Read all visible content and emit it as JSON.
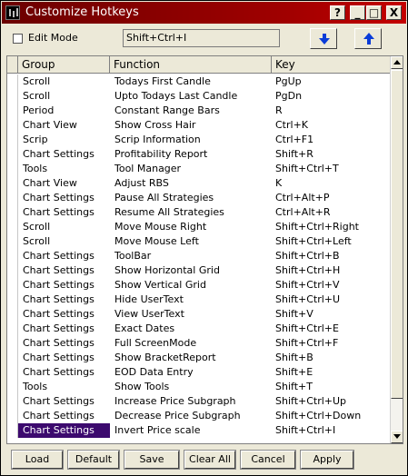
{
  "window": {
    "title": "Customize Hotkeys",
    "buttons": {
      "help": "?",
      "minimize": "_",
      "maximize": "□",
      "close": "X"
    }
  },
  "toolbar": {
    "edit_mode_label": "Edit Mode",
    "edit_mode_checked": false,
    "hotkey_value": "Shift+Ctrl+I"
  },
  "grid": {
    "columns": [
      "Group",
      "Function",
      "Key"
    ],
    "rows": [
      {
        "group": "Scroll",
        "function": "Todays First Candle",
        "key": "PgUp"
      },
      {
        "group": "Scroll",
        "function": "Upto Todays Last Candle",
        "key": "PgDn"
      },
      {
        "group": "Period",
        "function": "Constant Range Bars",
        "key": "R"
      },
      {
        "group": "Chart View",
        "function": "Show Cross Hair",
        "key": "Ctrl+K"
      },
      {
        "group": "Scrip",
        "function": "Scrip Information",
        "key": "Ctrl+F1"
      },
      {
        "group": "Chart Settings",
        "function": "Profitability Report",
        "key": "Shift+R"
      },
      {
        "group": "Tools",
        "function": "Tool Manager",
        "key": "Shift+Ctrl+T"
      },
      {
        "group": "Chart View",
        "function": "Adjust RBS",
        "key": "K"
      },
      {
        "group": "Chart Settings",
        "function": "Pause All Strategies",
        "key": "Ctrl+Alt+P"
      },
      {
        "group": "Chart Settings",
        "function": "Resume All Strategies",
        "key": "Ctrl+Alt+R"
      },
      {
        "group": "Scroll",
        "function": "Move Mouse Right",
        "key": "Shift+Ctrl+Right"
      },
      {
        "group": "Scroll",
        "function": "Move Mouse Left",
        "key": "Shift+Ctrl+Left"
      },
      {
        "group": "Chart Settings",
        "function": "ToolBar",
        "key": "Shift+Ctrl+B"
      },
      {
        "group": "Chart Settings",
        "function": "Show Horizontal Grid",
        "key": "Shift+Ctrl+H"
      },
      {
        "group": "Chart Settings",
        "function": "Show Vertical Grid",
        "key": "Shift+Ctrl+V"
      },
      {
        "group": "Chart Settings",
        "function": "Hide UserText",
        "key": "Shift+Ctrl+U"
      },
      {
        "group": "Chart Settings",
        "function": "View UserText",
        "key": "Shift+V"
      },
      {
        "group": "Chart Settings",
        "function": "Exact Dates",
        "key": "Shift+Ctrl+E"
      },
      {
        "group": "Chart Settings",
        "function": "Full ScreenMode",
        "key": "Shift+Ctrl+F"
      },
      {
        "group": "Chart Settings",
        "function": "Show BracketReport",
        "key": "Shift+B"
      },
      {
        "group": "Chart Settings",
        "function": "EOD Data Entry",
        "key": "Shift+E"
      },
      {
        "group": "Tools",
        "function": "Show Tools",
        "key": "Shift+T"
      },
      {
        "group": "Chart Settings",
        "function": "Increase Price Subgraph",
        "key": "Shift+Ctrl+Up"
      },
      {
        "group": "Chart Settings",
        "function": "Decrease Price Subgraph",
        "key": "Shift+Ctrl+Down"
      },
      {
        "group": "Chart Settings",
        "function": "Invert Price scale",
        "key": "Shift+Ctrl+I",
        "selected": true
      }
    ]
  },
  "buttons": {
    "load": "Load",
    "default": "Default",
    "save": "Save",
    "clear_all": "Clear All",
    "cancel": "Cancel",
    "apply": "Apply"
  },
  "icons": {
    "move_up": "arrow-up-icon",
    "move_down": "arrow-down-icon",
    "accent": "#0a3cd8",
    "title_gradient_start": "#6b0000",
    "title_gradient_end": "#c40000",
    "selection": "#3c0a6e"
  }
}
